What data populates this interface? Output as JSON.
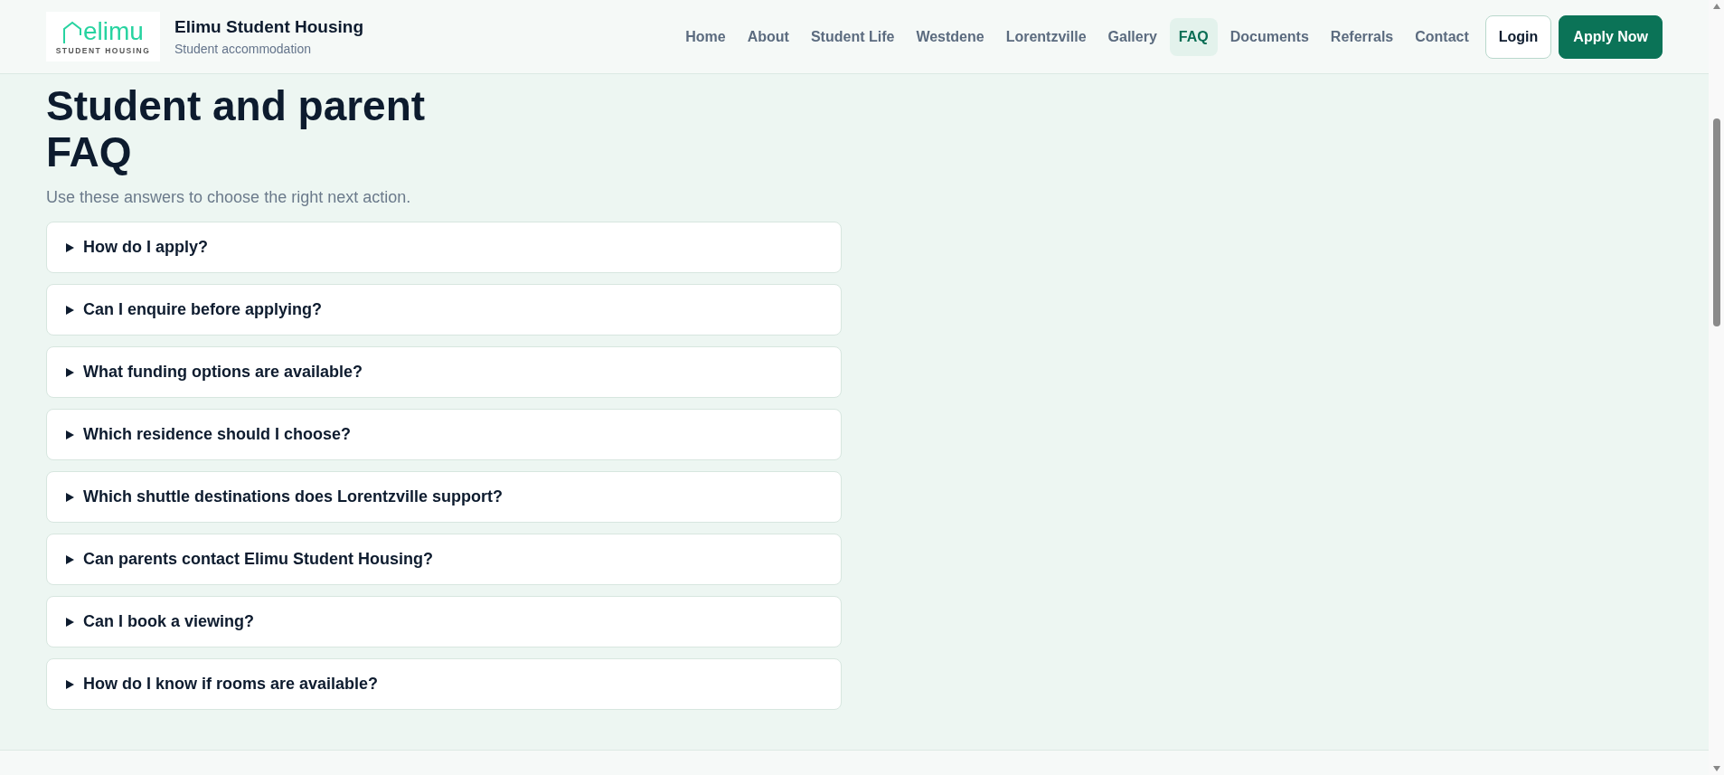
{
  "header": {
    "logo": {
      "wordmark": "elimu",
      "tagline": "STUDENT HOUSING"
    },
    "title": "Elimu Student Housing",
    "subtitle": "Student accommodation"
  },
  "nav": [
    {
      "label": "Home",
      "selected": false
    },
    {
      "label": "About",
      "selected": false
    },
    {
      "label": "Student Life",
      "selected": false
    },
    {
      "label": "Westdene",
      "selected": false
    },
    {
      "label": "Lorentzville",
      "selected": false
    },
    {
      "label": "Gallery",
      "selected": false
    },
    {
      "label": "FAQ",
      "selected": true
    },
    {
      "label": "Documents",
      "selected": false
    },
    {
      "label": "Referrals",
      "selected": false
    },
    {
      "label": "Contact",
      "selected": false
    }
  ],
  "actions": [
    {
      "label": "Login",
      "kind": "outline"
    },
    {
      "label": "Apply Now",
      "kind": "primary"
    }
  ],
  "page": {
    "title": "Student and parent FAQ",
    "lead": "Use these answers to choose the right next action."
  },
  "faq": [
    {
      "question": "How do I apply?",
      "expanded": false
    },
    {
      "question": "Can I enquire before applying?",
      "expanded": false
    },
    {
      "question": "What funding options are available?",
      "expanded": false
    },
    {
      "question": "Which residence should I choose?",
      "expanded": false
    },
    {
      "question": "Which shuttle destinations does Lorentzville support?",
      "expanded": false
    },
    {
      "question": "Can parents contact Elimu Student Housing?",
      "expanded": false
    },
    {
      "question": "Can I book a viewing?",
      "expanded": false
    },
    {
      "question": "How do I know if rooms are available?",
      "expanded": false
    }
  ]
}
